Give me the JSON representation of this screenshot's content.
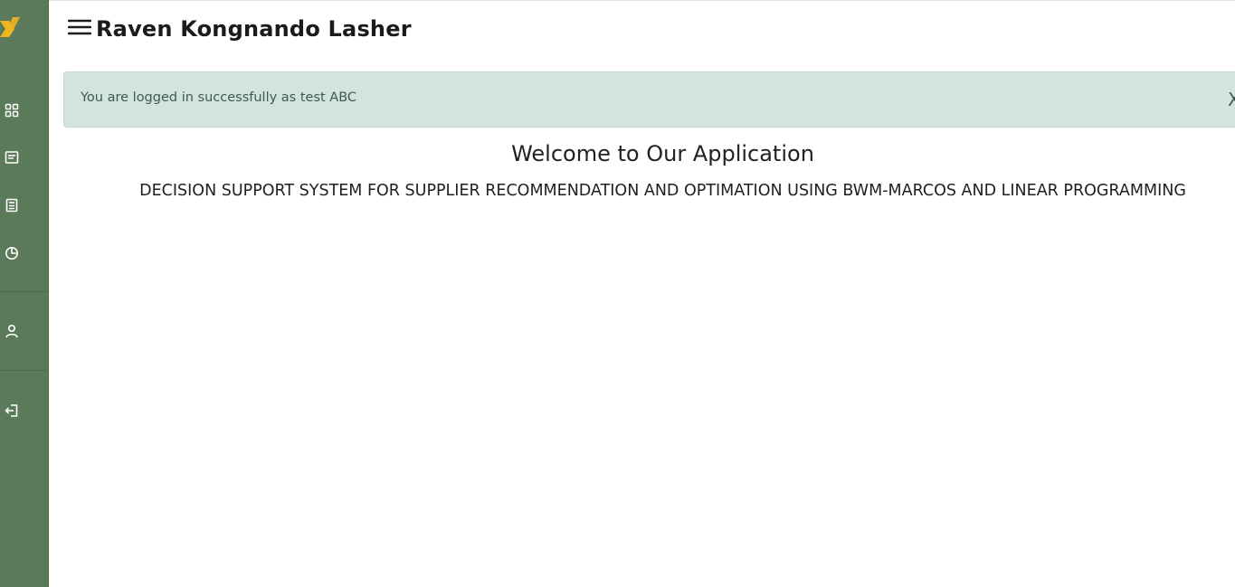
{
  "app": {
    "user_name": "Raven Kongnando Lasher"
  },
  "sidebar": {
    "logo_icon": "x-logo-icon",
    "items": [
      {
        "icon": "dashboard-grid-icon"
      },
      {
        "icon": "document-icon"
      },
      {
        "icon": "calculator-icon"
      },
      {
        "icon": "pie-chart-icon"
      },
      {
        "icon": "user-icon"
      },
      {
        "icon": "logout-icon"
      }
    ]
  },
  "alert": {
    "message": "You are logged in successfully as test ABC",
    "close_label": "X"
  },
  "main": {
    "welcome": "Welcome to Our Application",
    "subtitle": "DECISION SUPPORT SYSTEM FOR SUPPLIER RECOMMENDATION AND OPTIMATION USING BWM-MARCOS AND LINEAR PROGRAMMING"
  },
  "colors": {
    "sidebar_bg": "#5a7a5a",
    "logo_accent": "#f2b51f",
    "alert_bg": "#d2e4dc",
    "alert_text": "#3f5a4f"
  }
}
